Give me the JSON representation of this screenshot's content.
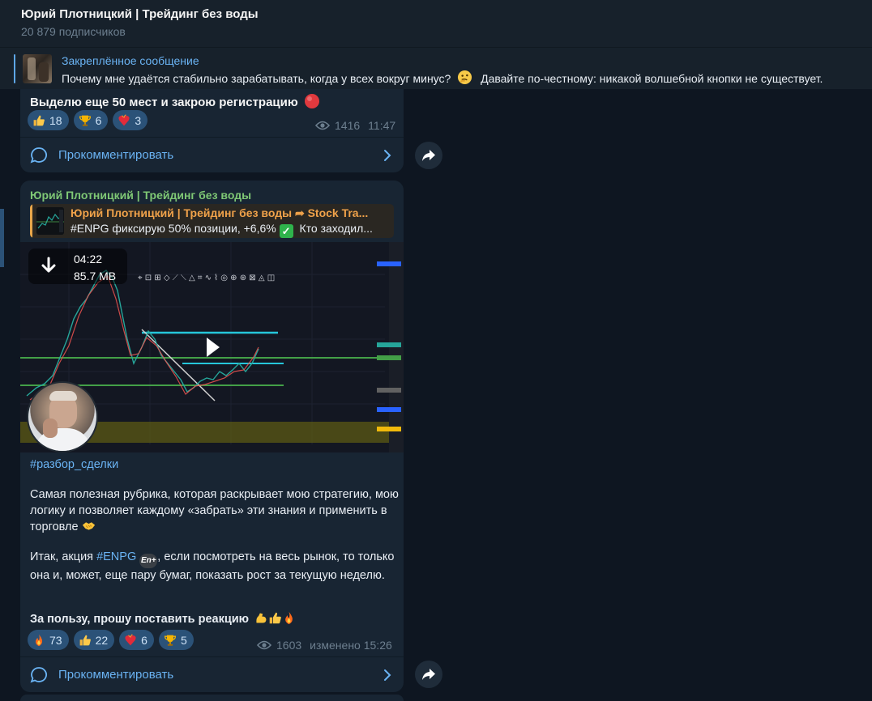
{
  "header": {
    "channel_title": "Юрий Плотницкий | Трейдинг без воды",
    "subscribers": "20 879 подписчиков"
  },
  "pinned": {
    "label": "Закреплённое сообщение",
    "text": "Почему мне удаётся стабильно зарабатывать, когда у всех вокруг минус?",
    "text_tail": "Давайте по-честному: никакой волшебной кнопки не существует."
  },
  "message1": {
    "text": "Выделю еще 50 мест и закрою регистрацию",
    "reactions": [
      {
        "icon": "thumbs-up",
        "count": "18"
      },
      {
        "icon": "trophy",
        "count": "6"
      },
      {
        "icon": "heart-on-fire",
        "count": "3"
      }
    ],
    "views": "1416",
    "time": "11:47",
    "comment_label": "Прокомментировать"
  },
  "message2": {
    "author": "Юрий Плотницкий | Трейдинг без воды",
    "reply": {
      "title": "Юрий Плотницкий | Трейдинг без воды ➦ Stock Tra...",
      "text_prefix": "#ENPG фиксирую 50% позиции, +6,6%",
      "text_suffix": "Кто заходил..."
    },
    "video": {
      "duration": "04:22",
      "size": "85.7 MB"
    },
    "hashtag": "#разбор_сделки",
    "paragraph1": "Самая полезная рубрика, которая раскрывает мою стратегию, мою логику и позволяет каждому «забрать» эти знания и применить в торговле",
    "paragraph2_prefix": "Итак, акция ",
    "paragraph2_tag": "#ENPG",
    "paragraph2_badge": "En+",
    "paragraph2_suffix": ", если посмотреть на весь рынок, то только она и, может, еще пару бумаг, показать рост за текущую неделю.",
    "closing": "За пользу, прошу поставить реакцию",
    "reactions": [
      {
        "icon": "fire",
        "count": "73"
      },
      {
        "icon": "thumbs-up",
        "count": "22"
      },
      {
        "icon": "heart-on-fire",
        "count": "6"
      },
      {
        "icon": "trophy",
        "count": "5"
      }
    ],
    "views": "1603",
    "time": "изменено 15:26",
    "comment_label": "Прокомментировать"
  },
  "colors": {
    "background": "#0e1621",
    "bubble": "#182533",
    "accent": "#6ab3f3",
    "author": "#7fc875",
    "reaction_bg": "#2b5278"
  }
}
